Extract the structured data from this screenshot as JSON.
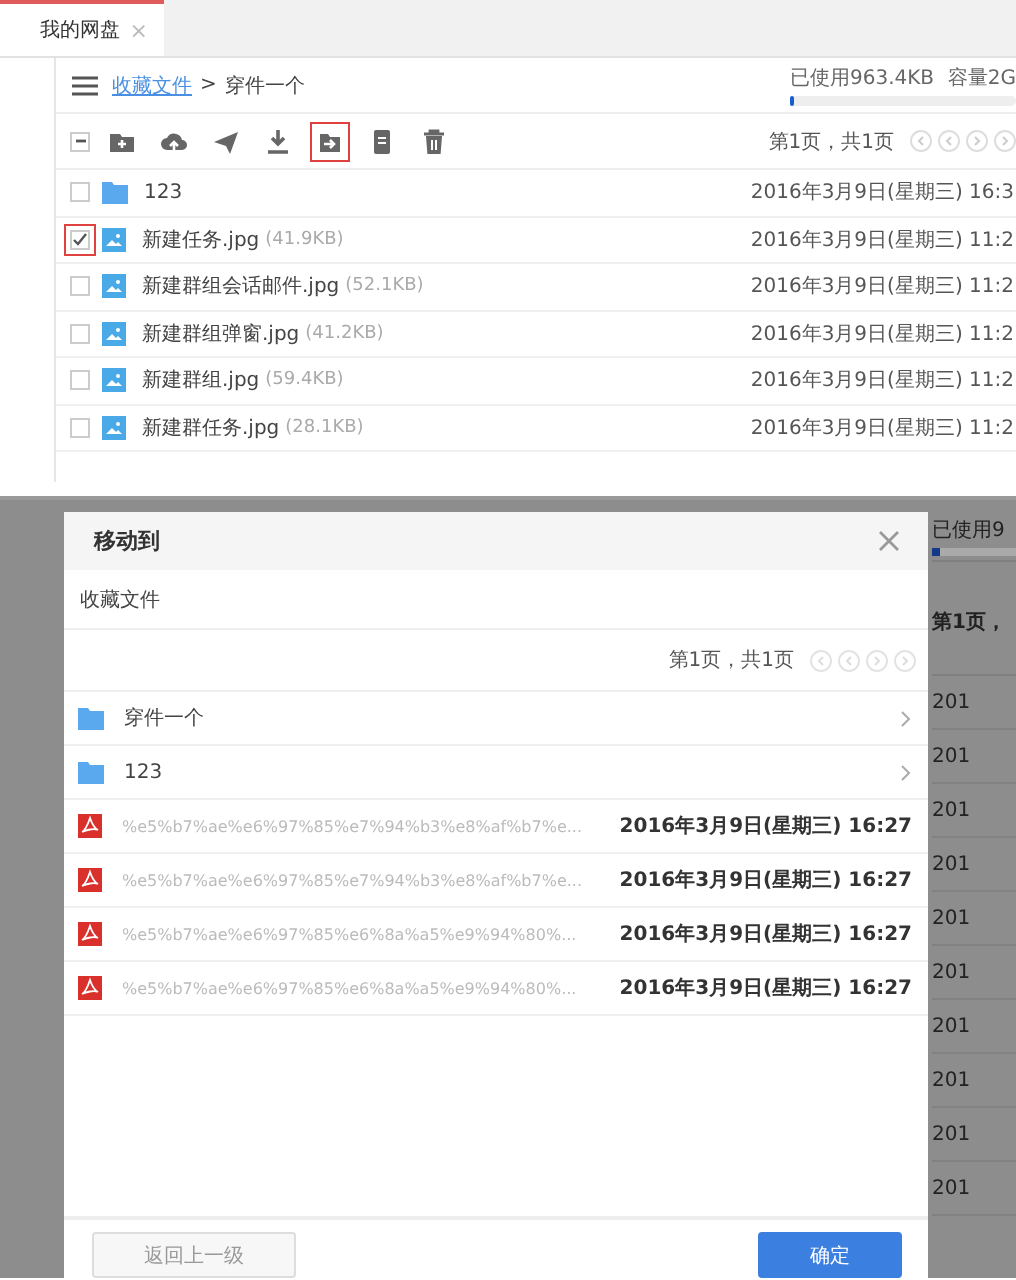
{
  "tab": {
    "label": "我的网盘",
    "close": "×",
    "selected": true
  },
  "breadcrumb": {
    "link": "收藏文件",
    "separator": ">",
    "current": "穿件一个"
  },
  "storage": {
    "used": "已使用963.4KB",
    "capacity": "容量2G",
    "level": 0.02
  },
  "toolbar": {
    "select_all_indeterminate": true,
    "tools": [
      {
        "kind": "new-folder",
        "selected": false
      },
      {
        "kind": "upload",
        "selected": false
      },
      {
        "kind": "send",
        "selected": false
      },
      {
        "kind": "download",
        "selected": false
      },
      {
        "kind": "move",
        "selected": true
      },
      {
        "kind": "copy",
        "selected": false
      },
      {
        "kind": "delete",
        "selected": false
      }
    ],
    "pager": "第1页，共1页"
  },
  "files": [
    {
      "kind": "folder",
      "name": "123",
      "checked": false,
      "date": "2016年3月9日(星期三) 16:3"
    },
    {
      "kind": "image",
      "name": "新建任务.jpg",
      "size": "(41.9KB)",
      "checked": true,
      "date": "2016年3月9日(星期三) 11:2"
    },
    {
      "kind": "image",
      "name": "新建群组会话邮件.jpg",
      "size": "(52.1KB)",
      "checked": false,
      "date": "2016年3月9日(星期三) 11:2"
    },
    {
      "kind": "image",
      "name": "新建群组弹窗.jpg",
      "size": "(41.2KB)",
      "checked": false,
      "date": "2016年3月9日(星期三) 11:2"
    },
    {
      "kind": "image",
      "name": "新建群组.jpg",
      "size": "(59.4KB)",
      "checked": false,
      "date": "2016年3月9日(星期三) 11:2"
    },
    {
      "kind": "image",
      "name": "新建群任务.jpg",
      "size": "(28.1KB)",
      "checked": false,
      "date": "2016年3月9日(星期三) 11:2"
    }
  ],
  "background": {
    "used": "已使用9",
    "level": 0.1,
    "pager": "第1页，",
    "dates": [
      "201",
      "201",
      "201",
      "201",
      "201",
      "201",
      "201",
      "201",
      "201",
      "201"
    ]
  },
  "dialog": {
    "title": "移动到",
    "path": "收藏文件",
    "pager": "第1页，共1页",
    "items": [
      {
        "kind": "folder",
        "name": "穿件一个",
        "disabled": false
      },
      {
        "kind": "folder",
        "name": "123",
        "disabled": false
      },
      {
        "kind": "pdf",
        "name": "%e5%b7%ae%e6%97%85%e7%94%b3%e8%af%b7%e...",
        "date": "2016年3月9日(星期三) 16:27",
        "disabled": true
      },
      {
        "kind": "pdf",
        "name": "%e5%b7%ae%e6%97%85%e7%94%b3%e8%af%b7%e...",
        "date": "2016年3月9日(星期三) 16:27",
        "disabled": true
      },
      {
        "kind": "pdf",
        "name": "%e5%b7%ae%e6%97%85%e6%8a%a5%e9%94%80%...",
        "date": "2016年3月9日(星期三) 16:27",
        "disabled": true
      },
      {
        "kind": "pdf",
        "name": "%e5%b7%ae%e6%97%85%e6%8a%a5%e9%94%80%...",
        "date": "2016年3月9日(星期三) 16:27",
        "disabled": true
      }
    ],
    "buttons": [
      {
        "kind": "back",
        "label": "返回上一级",
        "disabled": true
      },
      {
        "kind": "confirm",
        "label": "确定",
        "disabled": false
      }
    ]
  }
}
